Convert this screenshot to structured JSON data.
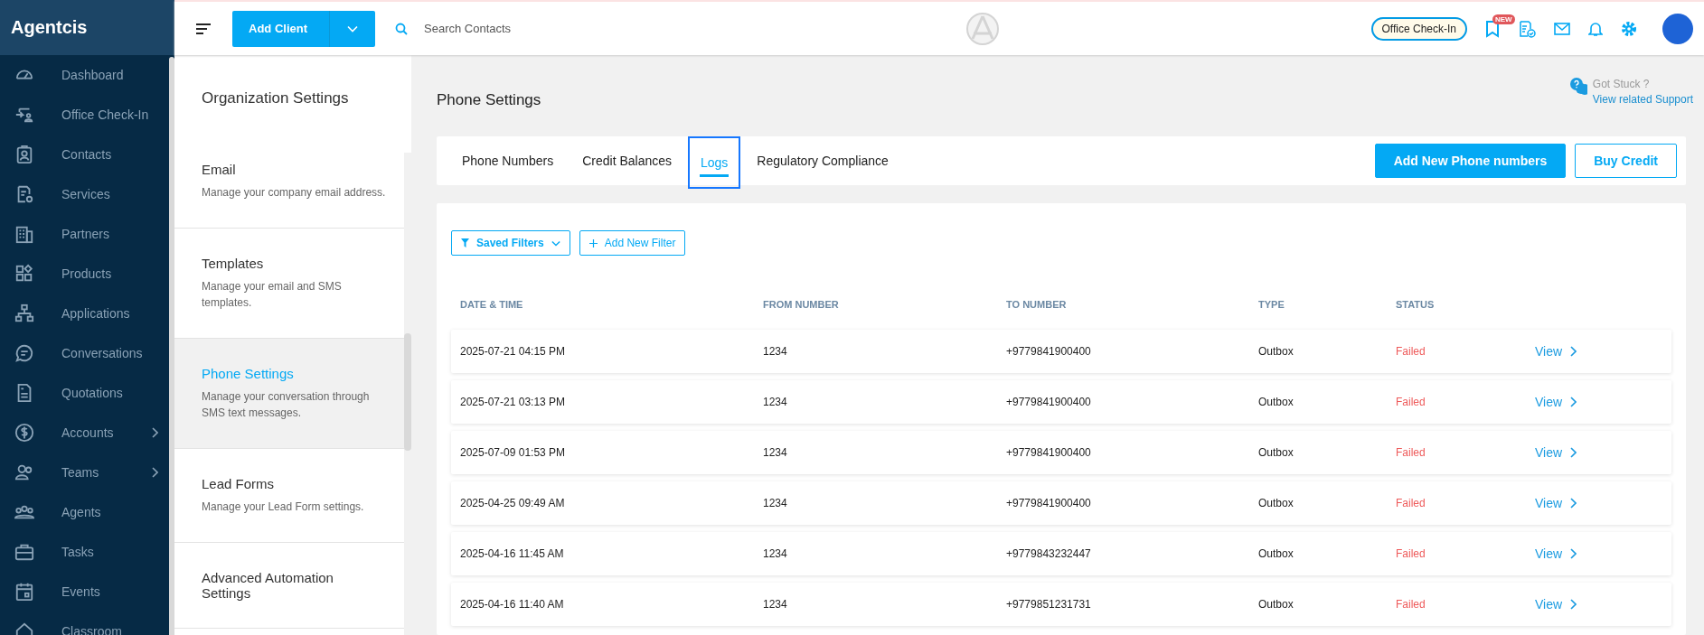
{
  "brand": "Agentcis",
  "sidebar": {
    "items": [
      {
        "label": "Dashboard",
        "has_submenu": false
      },
      {
        "label": "Office Check-In",
        "has_submenu": false
      },
      {
        "label": "Contacts",
        "has_submenu": false
      },
      {
        "label": "Services",
        "has_submenu": false
      },
      {
        "label": "Partners",
        "has_submenu": false
      },
      {
        "label": "Products",
        "has_submenu": false
      },
      {
        "label": "Applications",
        "has_submenu": false
      },
      {
        "label": "Conversations",
        "has_submenu": false
      },
      {
        "label": "Quotations",
        "has_submenu": false
      },
      {
        "label": "Accounts",
        "has_submenu": true
      },
      {
        "label": "Teams",
        "has_submenu": true
      },
      {
        "label": "Agents",
        "has_submenu": false
      },
      {
        "label": "Tasks",
        "has_submenu": false
      },
      {
        "label": "Events",
        "has_submenu": false
      },
      {
        "label": "Classroom",
        "has_submenu": false
      }
    ]
  },
  "topbar": {
    "add_client": "Add Client",
    "search": {
      "placeholder": "Search Contacts"
    },
    "office_checkin": "Office Check-In",
    "new_badge": "NEW"
  },
  "settings_nav": {
    "title": "Organization Settings",
    "items": [
      {
        "title": "Email",
        "description": "Manage your company email address.",
        "selected": false
      },
      {
        "title": "Templates",
        "description": "Manage your email and SMS templates.",
        "selected": false
      },
      {
        "title": "Phone Settings",
        "description": "Manage your conversation through SMS text messages.",
        "selected": true
      },
      {
        "title": "Lead Forms",
        "description": "Manage your Lead Form settings.",
        "selected": false
      },
      {
        "title": "Advanced Automation Settings",
        "selected": false
      }
    ]
  },
  "page": {
    "title": "Phone Settings",
    "help": {
      "question": "Got Stuck ?",
      "link": "View related Support"
    }
  },
  "tabs": [
    {
      "label": "Phone Numbers",
      "selected": false,
      "focused": false
    },
    {
      "label": "Credit Balances",
      "selected": false,
      "focused": false
    },
    {
      "label": "Logs",
      "selected": true,
      "focused": true
    },
    {
      "label": "Regulatory Compliance",
      "selected": false,
      "focused": false
    }
  ],
  "actions": [
    {
      "label": "Add New Phone numbers",
      "kind": "primary"
    },
    {
      "label": "Buy Credit",
      "kind": "outline"
    }
  ],
  "filters": [
    {
      "label": "Saved Filters",
      "kind": "dropdown"
    },
    {
      "label": "Add New Filter",
      "kind": "add"
    }
  ],
  "table": {
    "columns": [
      "DATE & TIME",
      "FROM NUMBER",
      "TO NUMBER",
      "TYPE",
      "STATUS"
    ],
    "rows": [
      {
        "date_time": "2025-07-21 04:15 PM",
        "from": "1234",
        "to": "+9779841900400",
        "type": "Outbox",
        "status": "Failed",
        "action": "View"
      },
      {
        "date_time": "2025-07-21 03:13 PM",
        "from": "1234",
        "to": "+9779841900400",
        "type": "Outbox",
        "status": "Failed",
        "action": "View"
      },
      {
        "date_time": "2025-07-09 01:53 PM",
        "from": "1234",
        "to": "+9779841900400",
        "type": "Outbox",
        "status": "Failed",
        "action": "View"
      },
      {
        "date_time": "2025-04-25 09:49 AM",
        "from": "1234",
        "to": "+9779841900400",
        "type": "Outbox",
        "status": "Failed",
        "action": "View"
      },
      {
        "date_time": "2025-04-16 11:45 AM",
        "from": "1234",
        "to": "+9779843232447",
        "type": "Outbox",
        "status": "Failed",
        "action": "View"
      },
      {
        "date_time": "2025-04-16 11:40 AM",
        "from": "1234",
        "to": "+9779851231731",
        "type": "Outbox",
        "status": "Failed",
        "action": "View"
      }
    ]
  }
}
